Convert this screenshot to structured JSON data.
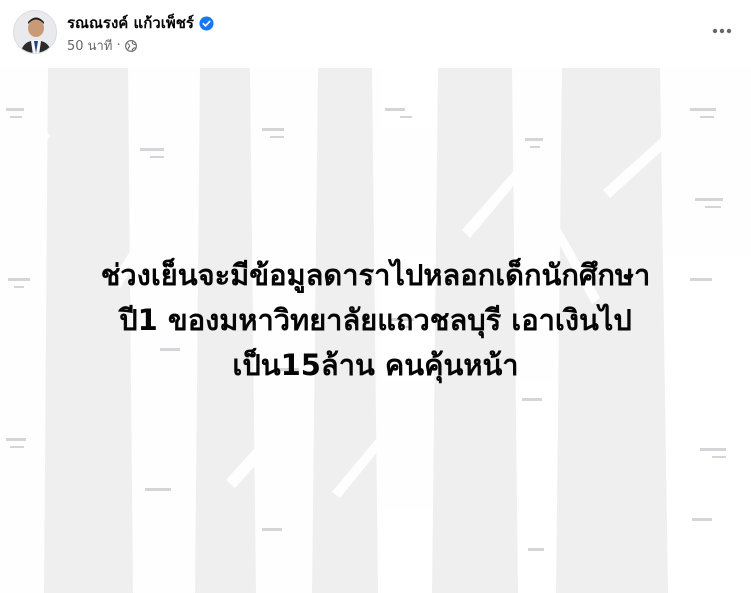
{
  "post": {
    "author_name": "รณณรงค์ แก้วเพ็ชร์",
    "timestamp": "50 นาที",
    "separator": "·",
    "privacy_icon": "globe-icon",
    "verified_icon": "verified-badge-icon",
    "more_icon": "more-dots-icon",
    "text": "ช่วงเย็นจะมีข้อมูลดาราไปหลอกเด็กนักศึกษา\nปี1 ของมหาวิทยาลัยแถวชลบุรี เอาเงินไป\nเป็น15ล้าน คนคุ้นหน้า"
  },
  "colors": {
    "verified": "#1877f2",
    "meta_text": "#65676b",
    "card_bg": "#efeff0",
    "tree": "#ffffff"
  }
}
